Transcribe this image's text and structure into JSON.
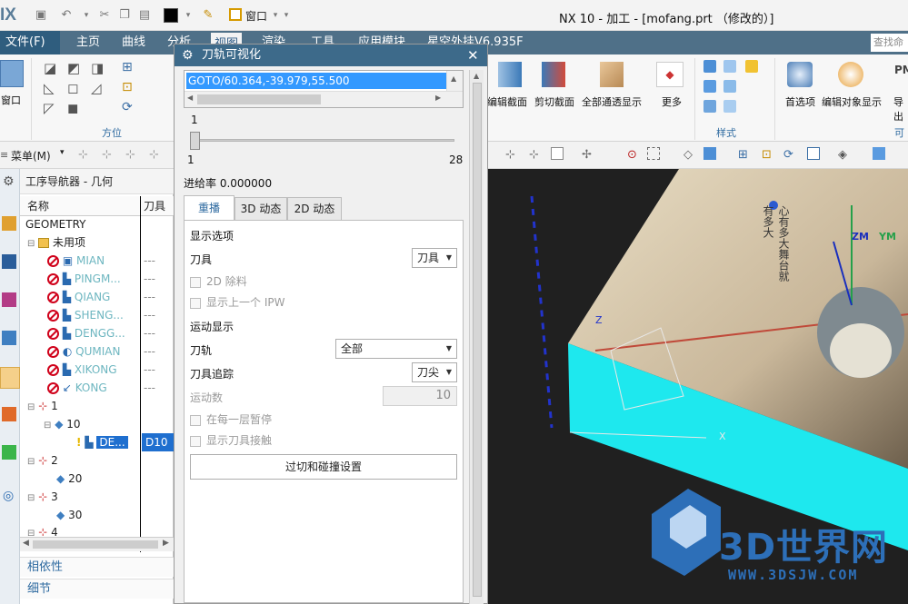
{
  "titlebar": {
    "logo": "IX",
    "window_menu": "窗口",
    "title": "NX 10 - 加工 - [mofang.prt （修改的）]"
  },
  "tabs": {
    "file": "文件(F)",
    "items": [
      "主页",
      "曲线",
      "分析",
      "视图",
      "渲染",
      "工具",
      "应用模块",
      "星空外挂V6.935F"
    ],
    "search_placeholder": "查找命令"
  },
  "ribbon": {
    "window_label": "窗口",
    "orient_group": "方位",
    "section_buttons": [
      "编辑截面",
      "剪切截面",
      "全部通透显示",
      "更多"
    ],
    "style_group": "样式",
    "pref_buttons": [
      "首选项",
      "编辑对象显示",
      "导出"
    ],
    "visible_group": "可视"
  },
  "toolbar2": {
    "menu": "菜单(M)"
  },
  "navigator": {
    "title": "工序导航器 - 几何",
    "col_name": "名称",
    "col_tool": "刀具",
    "root": "GEOMETRY",
    "unused": "未用项",
    "unused_ops": [
      {
        "name": "MIAN",
        "tool": "---"
      },
      {
        "name": "PINGM...",
        "tool": "---"
      },
      {
        "name": "QIANG",
        "tool": "---"
      },
      {
        "name": "SHENG...",
        "tool": "---"
      },
      {
        "name": "DENGG...",
        "tool": "---"
      },
      {
        "name": "QUMIAN",
        "tool": "---"
      },
      {
        "name": "XIKONG",
        "tool": "---"
      },
      {
        "name": "KONG",
        "tool": "---"
      }
    ],
    "nodes": [
      {
        "csys": "1",
        "wp": "10",
        "op": "DE...",
        "tool": "D10"
      },
      {
        "csys": "2",
        "wp": "20"
      },
      {
        "csys": "3",
        "wp": "30"
      },
      {
        "csys": "4"
      }
    ],
    "section_dep": "相依性",
    "section_detail": "细节"
  },
  "dialog": {
    "title": "刀轨可视化",
    "goto_line": "GOTO/60.364,-39.979,55.500",
    "slider_value": "1",
    "slider_min": "1",
    "slider_max": "28",
    "feed_rate": "进给率 0.000000",
    "tabs": [
      "重播",
      "3D 动态",
      "2D 动态"
    ],
    "display_options": "显示选项",
    "tool_label": "刀具",
    "tool_value": "刀具",
    "cb_2d": "2D 除料",
    "cb_prev_ipw": "显示上一个 IPW",
    "motion_display": "运动显示",
    "path_label": "刀轨",
    "path_value": "全部",
    "trace_label": "刀具追踪",
    "trace_value": "刀尖",
    "motion_count_label": "运动数",
    "motion_count": "10",
    "cb_pause": "在每一层暂停",
    "cb_show_engage": "显示刀具接触",
    "gouge_button": "过切和碰撞设置"
  },
  "viewport": {
    "watermark": "3D世界网",
    "watermark_url": "WWW.3DSJW.COM",
    "axis_x": "X",
    "axis_zm": "ZM",
    "axis_yv": "YM",
    "axis_z": "Z",
    "caption": "心有多大舞台就有多大"
  }
}
